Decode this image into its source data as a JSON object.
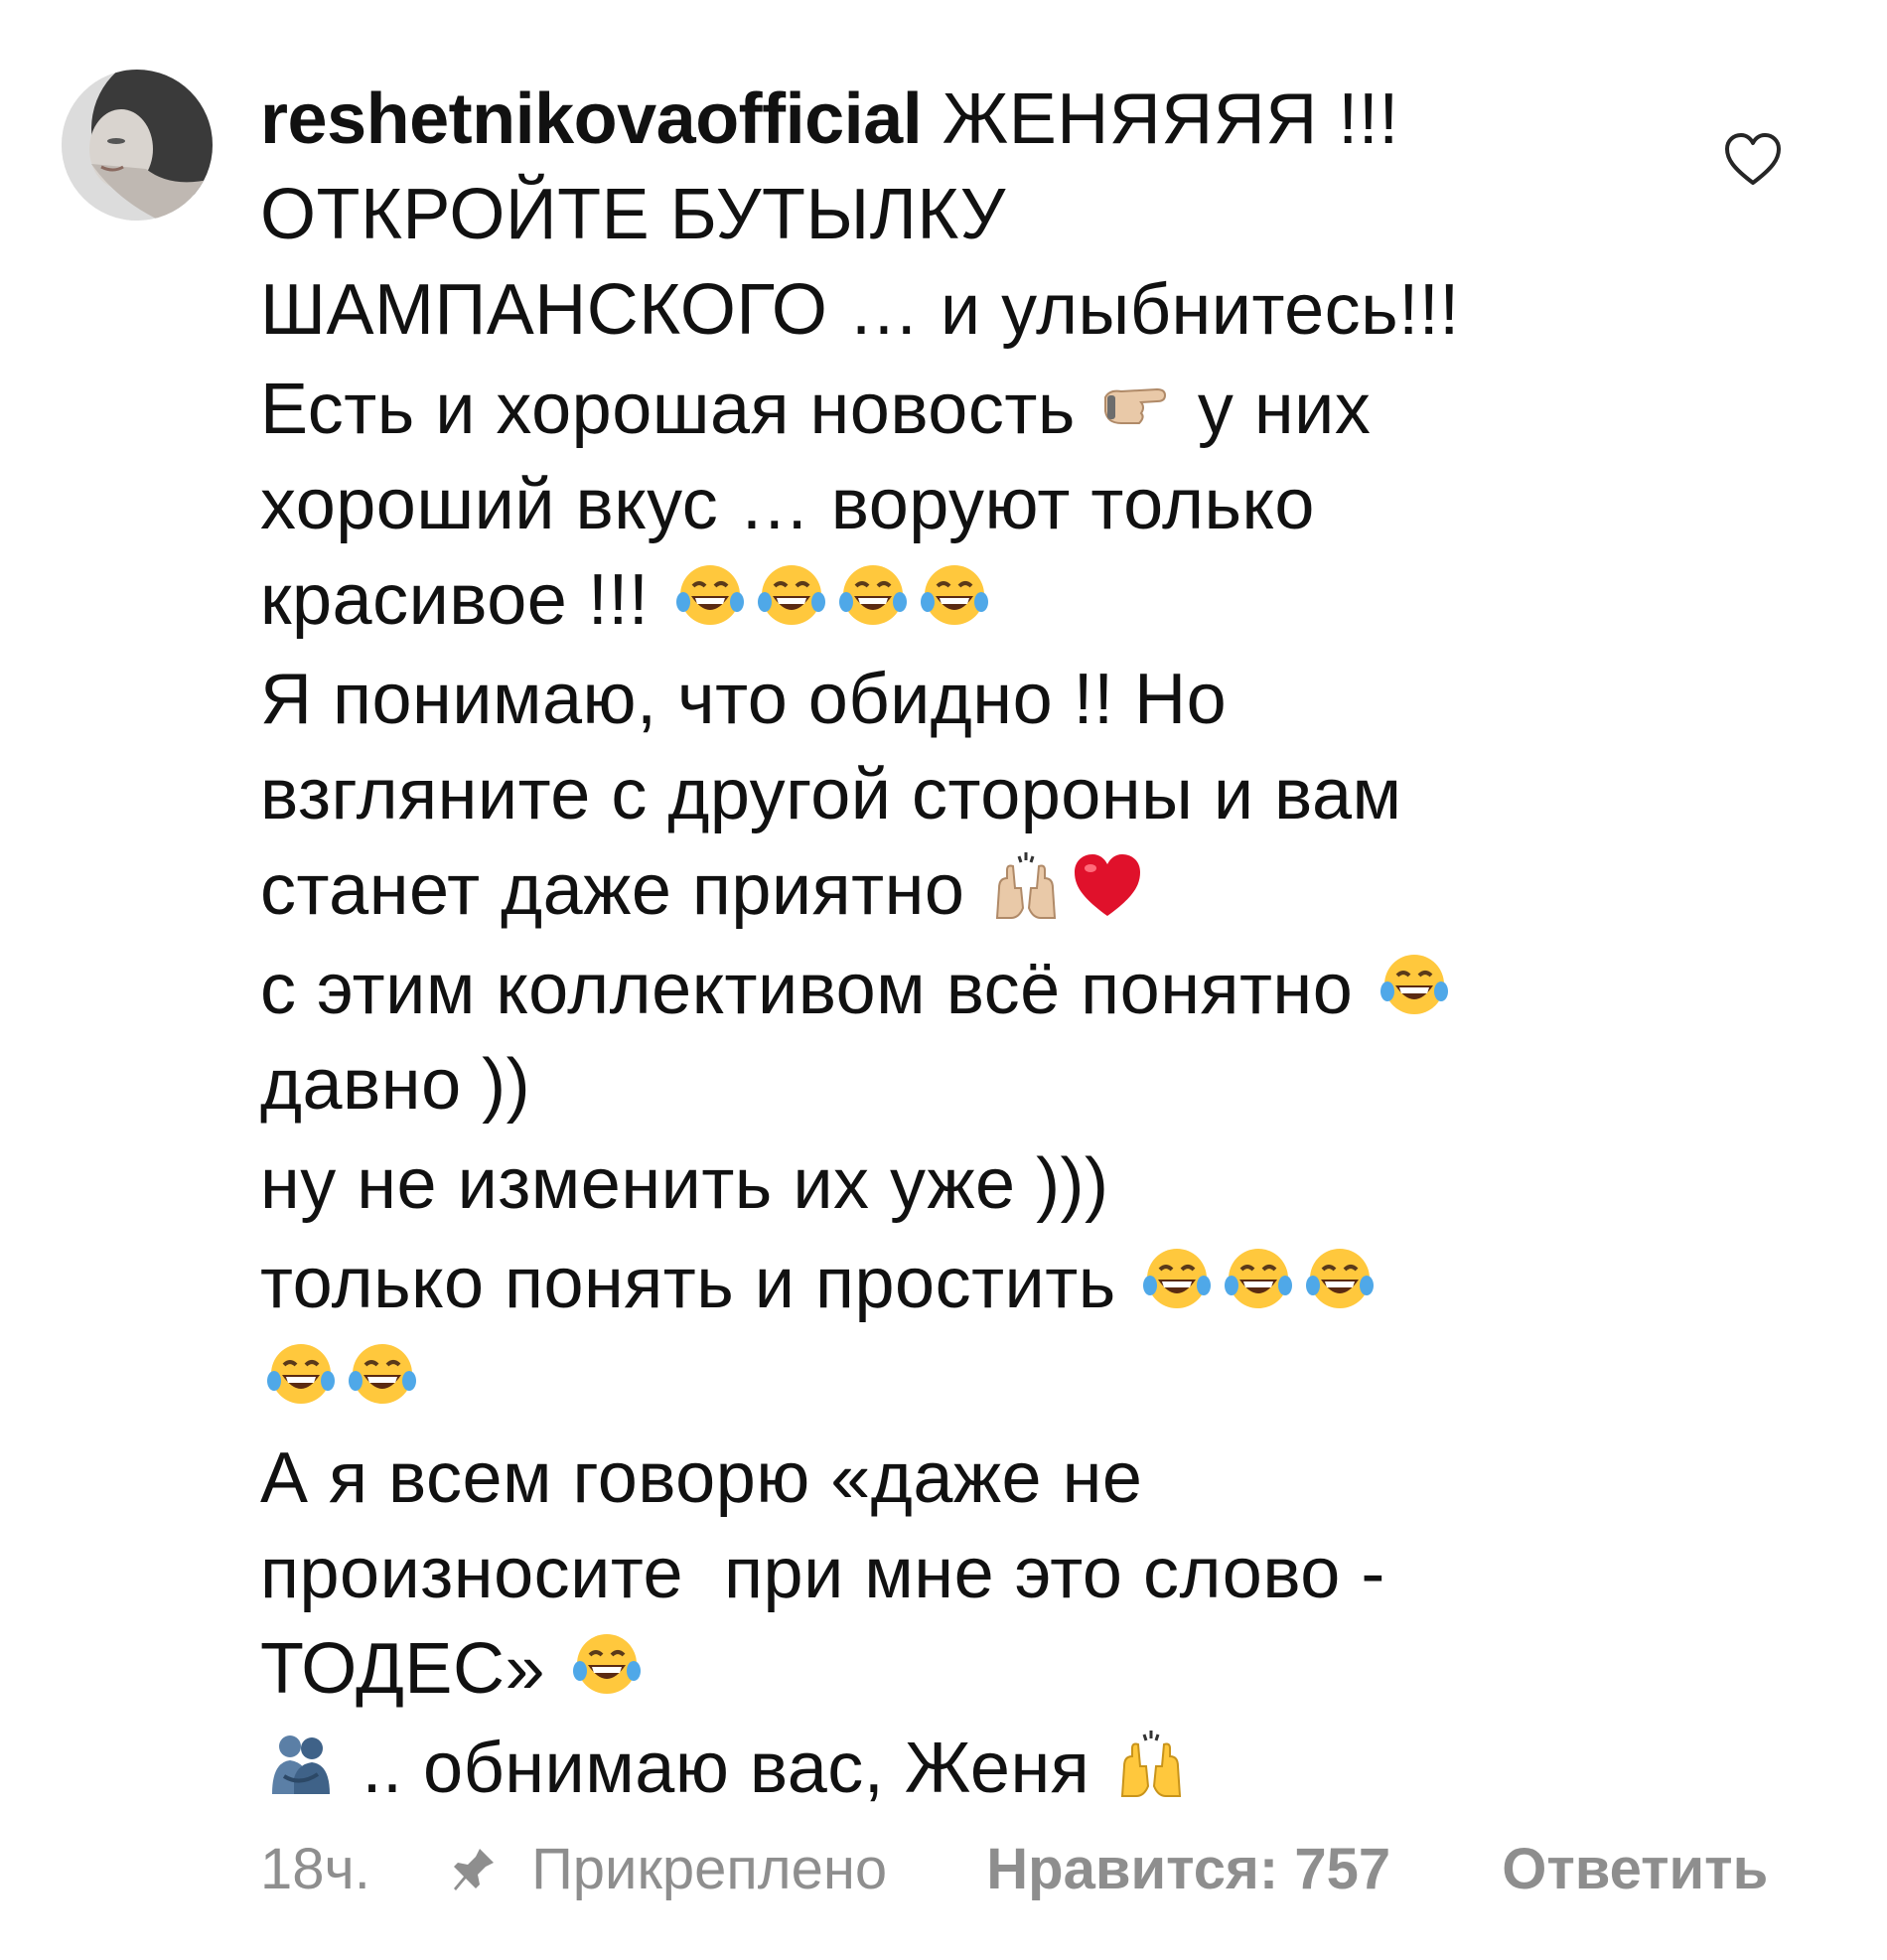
{
  "comment": {
    "username": "reshetnikovaofficial",
    "lines": [
      " ЖЕНЯЯЯЯ !!!",
      "ОТКРОЙТЕ БУТЫЛКУ",
      "ШАМПАНСКОГО … и улыбнитесь!!!",
      "Есть и хорошая новость",
      " у них",
      "хороший вкус … воруют только",
      "красивое !!!",
      "Я понимаю, что обидно !! Но",
      "взгляните с другой стороны и вам",
      "станет даже приятно",
      "с этим коллективом всё понятно",
      "давно ))",
      "ну не изменить их уже )))",
      "только понять и простить",
      "А я всем говорю «даже не",
      "произносите  при мне это слово -",
      "ТОДЕС»",
      " .. обнимаю вас, Женя"
    ],
    "emojis": {
      "pointing": "backhand-index-pointing-right-emoji",
      "laughing": "face-with-tears-of-joy-emoji",
      "raising_hands": "raising-hands-emoji",
      "heart": "red-heart-emoji",
      "hug": "people-hugging-emoji"
    }
  },
  "footer": {
    "time": "18ч.",
    "pinned": "Прикреплено",
    "likes": "Нравится: 757",
    "reply": "Ответить"
  },
  "colors": {
    "text": "#111111",
    "meta": "#8e8e8e",
    "emoji_yellow": "#FFC83D",
    "heart_red": "#E0112B"
  }
}
